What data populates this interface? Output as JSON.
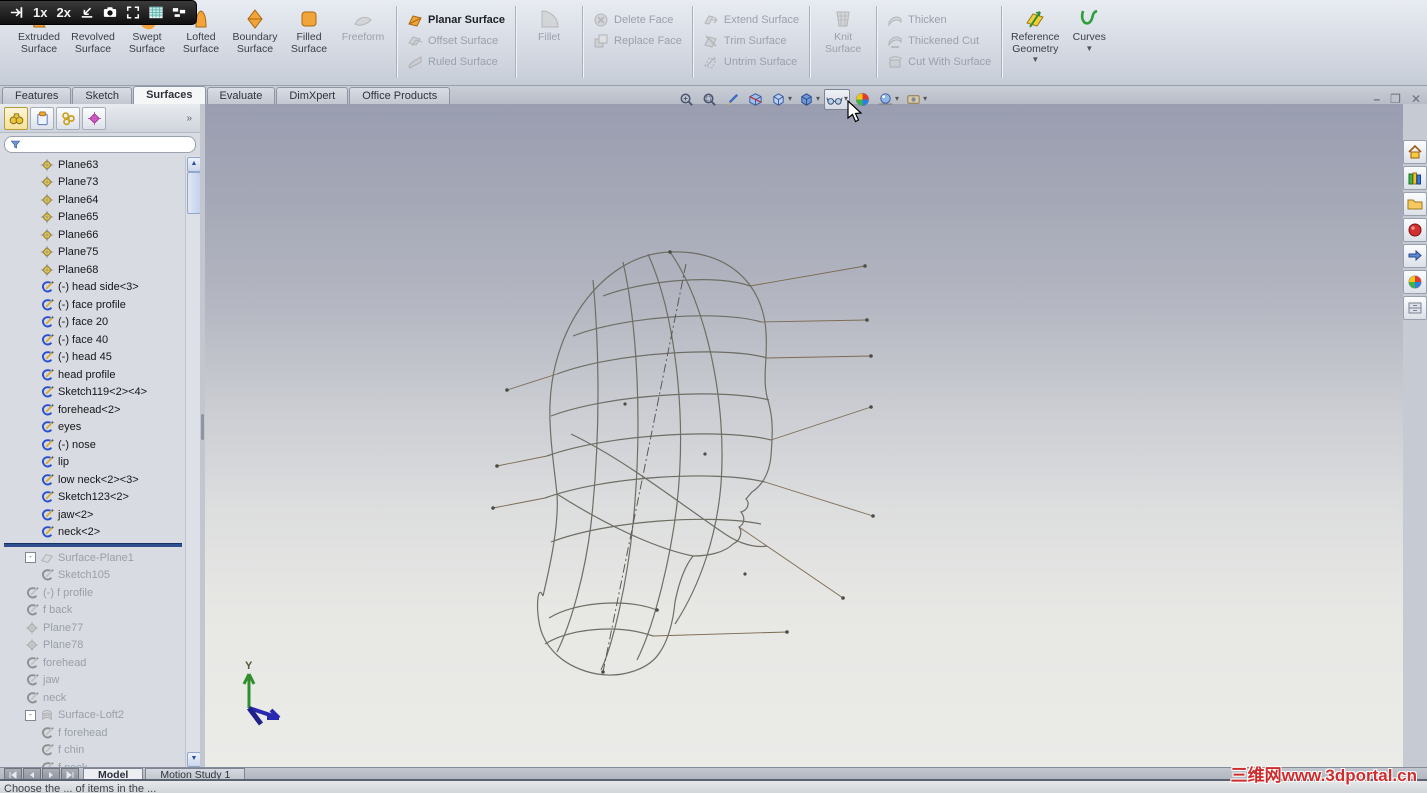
{
  "recorder_bar": {
    "speed_1x": "1x",
    "speed_2x": "2x",
    "icons": [
      "pin-icon",
      "import-icon",
      "camera-icon",
      "fullscreen-icon",
      "image-icon",
      "layout-icon"
    ]
  },
  "ribbon": {
    "groups": [
      {
        "layout": "big",
        "buttons": [
          {
            "label": "Extruded\nSurface",
            "icon": "extruded-surface-icon",
            "enabled": true
          },
          {
            "label": "Revolved\nSurface",
            "icon": "revolved-surface-icon",
            "enabled": true
          },
          {
            "label": "Swept\nSurface",
            "icon": "swept-surface-icon",
            "enabled": true
          },
          {
            "label": "Lofted\nSurface",
            "icon": "lofted-surface-icon",
            "enabled": true
          },
          {
            "label": "Boundary\nSurface",
            "icon": "boundary-surface-icon",
            "enabled": true
          },
          {
            "label": "Filled\nSurface",
            "icon": "filled-surface-icon",
            "enabled": true
          },
          {
            "label": "Freeform",
            "icon": "freeform-icon",
            "enabled": false
          }
        ]
      },
      {
        "layout": "stack",
        "buttons": [
          {
            "label": "Planar Surface",
            "icon": "planar-surface-icon",
            "enabled": true
          },
          {
            "label": "Offset Surface",
            "icon": "offset-surface-icon",
            "enabled": false
          },
          {
            "label": "Ruled Surface",
            "icon": "ruled-surface-icon",
            "enabled": false
          }
        ]
      },
      {
        "layout": "big",
        "buttons": [
          {
            "label": "Fillet",
            "icon": "fillet-icon",
            "enabled": false
          }
        ]
      },
      {
        "layout": "stack",
        "buttons": [
          {
            "label": "Delete Face",
            "icon": "delete-face-icon",
            "enabled": false
          },
          {
            "label": "Replace Face",
            "icon": "replace-face-icon",
            "enabled": false
          }
        ]
      },
      {
        "layout": "stack",
        "buttons": [
          {
            "label": "Extend Surface",
            "icon": "extend-surface-icon",
            "enabled": false
          },
          {
            "label": "Trim Surface",
            "icon": "trim-surface-icon",
            "enabled": false
          },
          {
            "label": "Untrim Surface",
            "icon": "untrim-surface-icon",
            "enabled": false
          }
        ]
      },
      {
        "layout": "big",
        "buttons": [
          {
            "label": "Knit\nSurface",
            "icon": "knit-surface-icon",
            "enabled": false
          }
        ]
      },
      {
        "layout": "stack",
        "buttons": [
          {
            "label": "Thicken",
            "icon": "thicken-icon",
            "enabled": false
          },
          {
            "label": "Thickened Cut",
            "icon": "thickened-cut-icon",
            "enabled": false
          },
          {
            "label": "Cut With Surface",
            "icon": "cut-with-surface-icon",
            "enabled": false
          }
        ]
      },
      {
        "layout": "big",
        "buttons": [
          {
            "label": "Reference\nGeometry",
            "icon": "reference-geometry-icon",
            "enabled": true,
            "dropdown": true
          },
          {
            "label": "Curves",
            "icon": "curves-icon",
            "enabled": true,
            "dropdown": true
          }
        ]
      }
    ]
  },
  "command_tabs": {
    "items": [
      {
        "label": "Features",
        "active": false
      },
      {
        "label": "Sketch",
        "active": false
      },
      {
        "label": "Surfaces",
        "active": true
      },
      {
        "label": "Evaluate",
        "active": false
      },
      {
        "label": "DimXpert",
        "active": false
      },
      {
        "label": "Office Products",
        "active": false
      }
    ]
  },
  "headsup_toolbar": {
    "buttons": [
      {
        "name": "zoom-to-fit-icon"
      },
      {
        "name": "zoom-to-area-icon"
      },
      {
        "name": "previous-view-icon"
      },
      {
        "name": "section-view-icon"
      },
      {
        "name": "view-orientation-icon",
        "dropdown": true
      },
      {
        "name": "display-style-icon",
        "dropdown": true
      },
      {
        "name": "hide-show-items-icon",
        "dropdown": true,
        "pressed": true
      },
      {
        "name": "edit-appearance-icon"
      },
      {
        "name": "apply-scene-icon",
        "dropdown": true
      },
      {
        "name": "view-settings-icon",
        "dropdown": true
      }
    ]
  },
  "window_controls": {
    "buttons": [
      {
        "name": "minimize-icon",
        "glyph": "–"
      },
      {
        "name": "restore-icon",
        "glyph": "❐"
      },
      {
        "name": "close-icon",
        "glyph": "✕"
      }
    ]
  },
  "left_panel": {
    "toolbar_icons": [
      "binoculars-icon",
      "clipboard-icon",
      "links-icon",
      "diamond-icon"
    ],
    "overflow_chevron": "»",
    "filter": {
      "icon": "filter-icon",
      "value": ""
    }
  },
  "feature_tree": {
    "items": [
      {
        "label": "Plane63",
        "icon": "plane-icon",
        "indent": 2
      },
      {
        "label": "Plane73",
        "icon": "plane-icon",
        "indent": 2
      },
      {
        "label": "Plane64",
        "icon": "plane-icon",
        "indent": 2
      },
      {
        "label": "Plane65",
        "icon": "plane-icon",
        "indent": 2
      },
      {
        "label": "Plane66",
        "icon": "plane-icon",
        "indent": 2
      },
      {
        "label": "Plane75",
        "icon": "plane-icon",
        "indent": 2
      },
      {
        "label": "Plane68",
        "icon": "plane-icon",
        "indent": 2
      },
      {
        "label": "(-) head side<3>",
        "icon": "sketch-icon",
        "indent": 2
      },
      {
        "label": "(-) face profile",
        "icon": "sketch-icon",
        "indent": 2
      },
      {
        "label": "(-) face 20",
        "icon": "sketch-icon",
        "indent": 2
      },
      {
        "label": "(-) face 40",
        "icon": "sketch-icon",
        "indent": 2
      },
      {
        "label": "(-) head 45",
        "icon": "sketch-icon",
        "indent": 2
      },
      {
        "label": "head profile",
        "icon": "sketch-icon",
        "indent": 2
      },
      {
        "label": "Sketch119<2><4>",
        "icon": "sketch-icon",
        "indent": 2
      },
      {
        "label": "forehead<2>",
        "icon": "sketch-icon",
        "indent": 2
      },
      {
        "label": "eyes",
        "icon": "sketch-icon",
        "indent": 2
      },
      {
        "label": "(-) nose",
        "icon": "sketch-icon",
        "indent": 2
      },
      {
        "label": "lip",
        "icon": "sketch-icon",
        "indent": 2
      },
      {
        "label": "low neck<2><3>",
        "icon": "sketch-icon",
        "indent": 2
      },
      {
        "label": "Sketch123<2>",
        "icon": "sketch-icon",
        "indent": 2
      },
      {
        "label": "jaw<2>",
        "icon": "sketch-icon",
        "indent": 2
      },
      {
        "label": "neck<2>",
        "icon": "sketch-icon",
        "indent": 2
      },
      {
        "rollback": true
      },
      {
        "label": "Surface-Plane1",
        "icon": "surface-plane-icon",
        "indent": 1,
        "expander": "-",
        "rolled": true
      },
      {
        "label": "Sketch105",
        "icon": "sketch-icon",
        "indent": 2,
        "rolled": true
      },
      {
        "label": "(-) f profile",
        "icon": "sketch-icon",
        "indent": 1,
        "rolled": true
      },
      {
        "label": "f back",
        "icon": "sketch-icon",
        "indent": 1,
        "rolled": true
      },
      {
        "label": "Plane77",
        "icon": "plane-icon",
        "indent": 1,
        "rolled": true
      },
      {
        "label": "Plane78",
        "icon": "plane-icon",
        "indent": 1,
        "rolled": true
      },
      {
        "label": "forehead",
        "icon": "sketch-icon",
        "indent": 1,
        "rolled": true
      },
      {
        "label": "jaw",
        "icon": "sketch-icon",
        "indent": 1,
        "rolled": true
      },
      {
        "label": "neck",
        "icon": "sketch-icon",
        "indent": 1,
        "rolled": true
      },
      {
        "label": "Surface-Loft2",
        "icon": "surface-loft-icon",
        "indent": 1,
        "expander": "-",
        "rolled": true
      },
      {
        "label": "f forehead",
        "icon": "sketch-icon",
        "indent": 2,
        "rolled": true
      },
      {
        "label": "f chin",
        "icon": "sketch-icon",
        "indent": 2,
        "rolled": true
      },
      {
        "label": "f neck",
        "icon": "sketch-icon",
        "indent": 2,
        "rolled": true
      }
    ]
  },
  "triad": {
    "y_label": "Y"
  },
  "task_pane": {
    "icons": [
      "house-icon",
      "books-icon",
      "folder-icon",
      "red-sphere-icon",
      "arrows-icon",
      "color-sphere-icon",
      "drawer-icon"
    ]
  },
  "bottom_bar": {
    "nav_icons": [
      "nav-first-icon",
      "nav-prev-icon",
      "nav-next-icon",
      "nav-last-icon"
    ],
    "tabs": [
      {
        "label": "Model",
        "active": true
      },
      {
        "label": "Motion Study 1",
        "active": false
      }
    ]
  },
  "status_bar": {
    "text": "Choose the ... of items in the ..."
  },
  "watermark": {
    "text": "三维网www.3dportal.cn"
  },
  "colors": {
    "accent_gold": "#f2cf3a",
    "sketch_blue": "#2a4fd0",
    "rollback_blue": "#2f4f8f",
    "watermark_red": "#cf2d2d",
    "wireframe": "#6e6e64",
    "recorder_black": "#101010"
  }
}
